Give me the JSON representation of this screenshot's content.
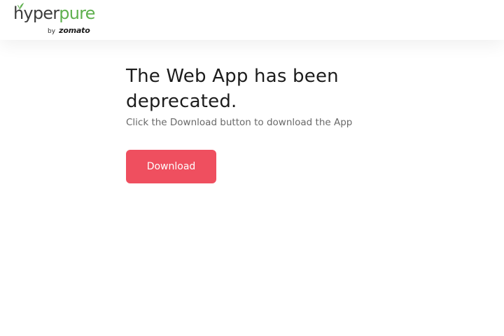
{
  "header": {
    "logo": {
      "part1": "hyper",
      "part2": "pure",
      "by": "by",
      "brand": "zomato"
    }
  },
  "main": {
    "title": "The Web App has been deprecated.",
    "subtitle": "Click the Download button to download the App",
    "download_label": "Download"
  },
  "colors": {
    "accent": "#ef4f5f",
    "logo_green": "#5fb04f",
    "title_text": "#1c1c1c",
    "subtitle_text": "#696969"
  },
  "icons": [
    "sprout-icon"
  ]
}
